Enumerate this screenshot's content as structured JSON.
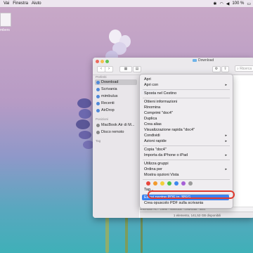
{
  "menubar": {
    "items": [
      "Vai",
      "Finestra",
      "Aiuto"
    ],
    "battery": "100 %",
    "icons": [
      "bluetooth-icon",
      "wifi-icon",
      "speaker-icon",
      "battery-icon"
    ]
  },
  "desktop": {
    "icon_label": "mbers"
  },
  "finder": {
    "title": "Download",
    "search_placeholder": "Ricerca",
    "sidebar": {
      "favorites_header": "Preferiti",
      "favorites": [
        "Download",
        "Scrivania",
        "mimbulus",
        "Recenti",
        "AirDrop"
      ],
      "locations_header": "Posizioni",
      "locations": [
        "MacBook Air di M...",
        "Disco remoto"
      ],
      "tags_header": "Tag"
    },
    "selected_file": "doc4",
    "path": "Macintosh HD › Utenti › mimbulus › Download › doc4",
    "status": "1 elemento, 141,53 GB disponibili"
  },
  "context_menu": {
    "items": [
      {
        "label": "Apri",
        "submenu": false
      },
      {
        "label": "Apri con",
        "submenu": true
      },
      {
        "label": "Sposta nel Cestino",
        "submenu": false
      },
      {
        "label": "Ottieni informazioni",
        "submenu": false
      },
      {
        "label": "Rinomina",
        "submenu": false
      },
      {
        "label": "Comprimi \"doc4\"",
        "submenu": false
      },
      {
        "label": "Duplica",
        "submenu": false
      },
      {
        "label": "Crea alias",
        "submenu": false
      },
      {
        "label": "Visualizzazione rapida \"doc4\"",
        "submenu": false
      },
      {
        "label": "Condividi",
        "submenu": true
      },
      {
        "label": "Azioni rapide",
        "submenu": true
      },
      {
        "label": "Copia \"doc4\"",
        "submenu": false
      },
      {
        "label": "Importa da iPhone o iPad",
        "submenu": true
      },
      {
        "label": "Utilizza gruppi",
        "submenu": false
      },
      {
        "label": "Ordina per",
        "submenu": true
      },
      {
        "label": "Mostra opzioni Vista",
        "submenu": false
      },
      {
        "label": "Tag...",
        "submenu": false
      },
      {
        "label": "Estrai pagine PDF in JPEG",
        "submenu": false
      },
      {
        "label": "Crea opuscolo PDF sulla scrivania",
        "submenu": false
      }
    ],
    "tag_colors": [
      "#e8463c",
      "#f29a2e",
      "#f2cf3a",
      "#4cbf4b",
      "#3b88ef",
      "#a65fd6",
      "#9b9b9b"
    ]
  },
  "colors": {
    "accent": "#3b82f0",
    "highlight_ring": "#e03a2e"
  }
}
